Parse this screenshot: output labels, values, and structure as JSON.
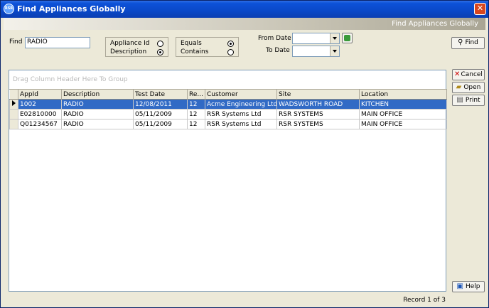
{
  "window": {
    "title": "Find Appliances Globally",
    "app_icon_text": "RSR"
  },
  "banner": {
    "text": "Find Appliances Globally"
  },
  "search": {
    "find_label": "Find",
    "find_value": "RADIO",
    "field_options": [
      {
        "label": "Appliance Id",
        "selected": false
      },
      {
        "label": "Description",
        "selected": true
      }
    ],
    "match_options": [
      {
        "label": "Equals",
        "selected": true
      },
      {
        "label": "Contains",
        "selected": false
      }
    ],
    "from_date_label": "From Date",
    "from_date_value": "",
    "to_date_label": "To Date",
    "to_date_value": ""
  },
  "buttons": {
    "find": "Find",
    "cancel": "Cancel",
    "open": "Open",
    "print": "Print",
    "help": "Help"
  },
  "grid": {
    "group_hint": "Drag Column Header Here To Group",
    "columns": [
      "AppId",
      "Description",
      "Test Date",
      "Re...",
      "Customer",
      "Site",
      "Location"
    ],
    "rows": [
      [
        "1002",
        "RADIO",
        "12/08/2011",
        "12",
        "Acme Engineering Ltd",
        "WADSWORTH ROAD",
        "KITCHEN"
      ],
      [
        "E02810000",
        "RADIO",
        "05/11/2009",
        "12",
        "RSR Systems Ltd",
        "RSR SYSTEMS",
        "MAIN OFFICE"
      ],
      [
        "Q01234567",
        "RADIO",
        "05/11/2009",
        "12",
        "RSR Systems Ltd",
        "RSR SYSTEMS",
        "MAIN OFFICE"
      ]
    ],
    "selected_row": 0
  },
  "status": {
    "record_text": "Record 1 of 3"
  },
  "colors": {
    "selection": "#316ac5",
    "titlebar": "#0a48c8",
    "window": "#ece9d8"
  }
}
